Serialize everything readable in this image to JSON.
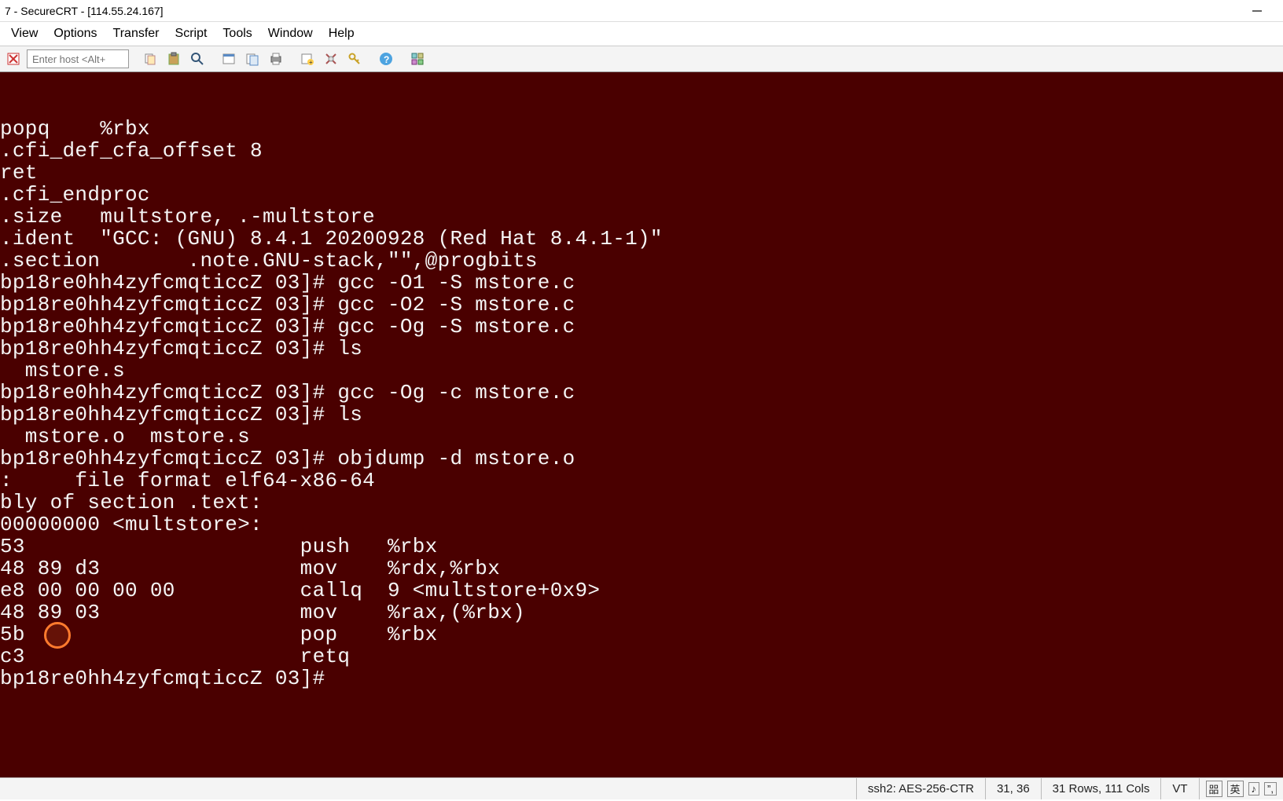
{
  "window": {
    "title": "7 - SecureCRT - [114.55.24.167]"
  },
  "menu": {
    "items": [
      "View",
      "Options",
      "Transfer",
      "Script",
      "Tools",
      "Window",
      "Help"
    ]
  },
  "toolbar": {
    "host_placeholder": "Enter host <Alt+"
  },
  "terminal": {
    "lines": [
      "popq    %rbx",
      ".cfi_def_cfa_offset 8",
      "ret",
      ".cfi_endproc",
      "",
      ".size   multstore, .-multstore",
      ".ident  \"GCC: (GNU) 8.4.1 20200928 (Red Hat 8.4.1-1)\"",
      ".section       .note.GNU-stack,\"\",@progbits",
      "bp18re0hh4zyfcmqticcZ 03]# gcc -O1 -S mstore.c",
      "bp18re0hh4zyfcmqticcZ 03]# gcc -O2 -S mstore.c",
      "bp18re0hh4zyfcmqticcZ 03]# gcc -Og -S mstore.c",
      "bp18re0hh4zyfcmqticcZ 03]# ls",
      "  mstore.s",
      "bp18re0hh4zyfcmqticcZ 03]# gcc -Og -c mstore.c",
      "bp18re0hh4zyfcmqticcZ 03]# ls",
      "  mstore.o  mstore.s",
      "bp18re0hh4zyfcmqticcZ 03]# objdump -d mstore.o",
      "",
      ":     file format elf64-x86-64",
      "",
      "",
      "bly of section .text:",
      "",
      "00000000 <multstore>:",
      "53                      push   %rbx",
      "48 89 d3                mov    %rdx,%rbx",
      "e8 00 00 00 00          callq  9 <multstore+0x9>",
      "48 89 03                mov    %rax,(%rbx)",
      "5b                      pop    %rbx",
      "c3                      retq",
      "bp18re0hh4zyfcmqticcZ 03]# "
    ]
  },
  "status": {
    "protocol": "ssh2: AES-256-CTR",
    "cursor": "31,  36",
    "size": "31 Rows, 111 Cols",
    "mode": "VT",
    "ime1": "㗊",
    "ime2": "英",
    "ime3": "♪",
    "ime4": "”,"
  },
  "icons": {
    "disconnect": "disconnect-icon",
    "copy": "copy-icon",
    "paste": "paste-icon",
    "find": "find-icon",
    "print": "print-icon",
    "printsetup": "print-setup-icon",
    "newsession": "new-session-icon",
    "settings": "settings-icon",
    "key": "key-icon",
    "help": "help-icon",
    "tile": "tile-icon"
  }
}
